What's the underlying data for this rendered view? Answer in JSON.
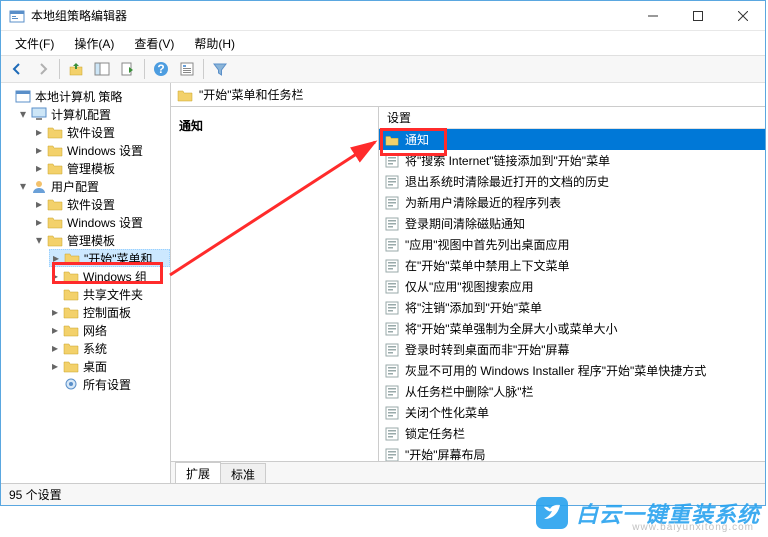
{
  "window": {
    "title": "本地组策略编辑器"
  },
  "menu": {
    "file": "文件(F)",
    "action": "操作(A)",
    "view": "查看(V)",
    "help": "帮助(H)"
  },
  "tree": {
    "root": "本地计算机 策略",
    "computer_config": "计算机配置",
    "cc_software": "软件设置",
    "cc_windows": "Windows 设置",
    "cc_templates": "管理模板",
    "user_config": "用户配置",
    "uc_software": "软件设置",
    "uc_windows": "Windows 设置",
    "uc_templates": "管理模板",
    "start_menu": "\"开始\"菜单和",
    "windows_components": "Windows 组",
    "shared_folders": "共享文件夹",
    "control_panel": "控制面板",
    "network": "网络",
    "system": "系统",
    "desktop": "桌面",
    "all_settings": "所有设置"
  },
  "content": {
    "header": "\"开始\"菜单和任务栏",
    "left_title": "通知",
    "column_header": "设置"
  },
  "settings": [
    "通知",
    "将\"搜索 Internet\"链接添加到\"开始\"菜单",
    "退出系统时清除最近打开的文档的历史",
    "为新用户清除最近的程序列表",
    "登录期间清除磁贴通知",
    "\"应用\"视图中首先列出桌面应用",
    "在\"开始\"菜单中禁用上下文菜单",
    "仅从\"应用\"视图搜索应用",
    "将\"注销\"添加到\"开始\"菜单",
    "将\"开始\"菜单强制为全屏大小或菜单大小",
    "登录时转到桌面而非\"开始\"屏幕",
    "灰显不可用的 Windows Installer 程序\"开始\"菜单快捷方式",
    "从任务栏中删除\"人脉\"栏",
    "关闭个性化菜单",
    "锁定任务栏",
    "\"开始\"屏幕布局"
  ],
  "tabs": {
    "extended": "扩展",
    "standard": "标准"
  },
  "statusbar": "95 个设置",
  "watermark": {
    "text": "白云一键重装系统",
    "url": "www.baiyunxitong.com"
  }
}
